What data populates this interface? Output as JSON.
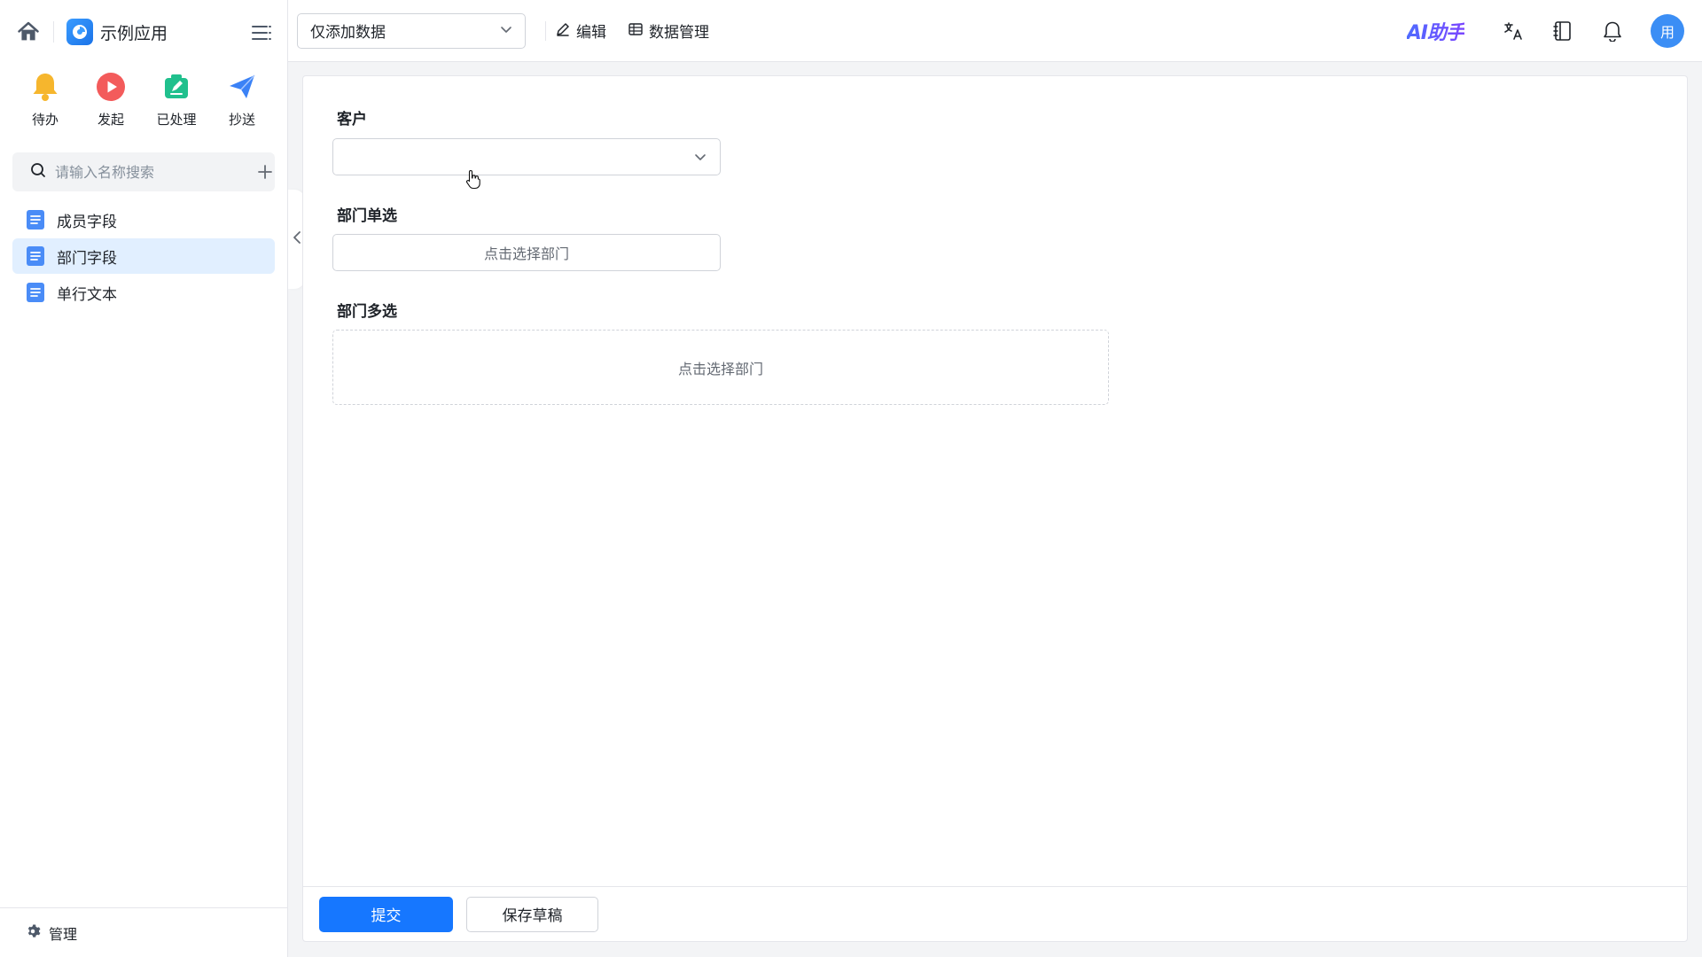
{
  "app": {
    "name": "示例应用"
  },
  "quick_actions": [
    {
      "label": "待办",
      "icon": "bell-icon",
      "color": "#f6b62d"
    },
    {
      "label": "发起",
      "icon": "play-icon",
      "color": "#f35b5b"
    },
    {
      "label": "已处理",
      "icon": "edit-square-icon",
      "color": "#20c08d"
    },
    {
      "label": "抄送",
      "icon": "paper-plane-icon",
      "color": "#3b82f6"
    }
  ],
  "search": {
    "placeholder": "请输入名称搜索"
  },
  "nav": {
    "items": [
      {
        "label": "成员字段",
        "active": false
      },
      {
        "label": "部门字段",
        "active": true
      },
      {
        "label": "单行文本",
        "active": false
      }
    ]
  },
  "footer": {
    "manage_label": "管理"
  },
  "topbar": {
    "view_select": "仅添加数据",
    "edit_label": "编辑",
    "data_manage_label": "数据管理",
    "ai_helper": "AI助手",
    "avatar_text": "用"
  },
  "form": {
    "customer_label": "客户",
    "customer_value": "",
    "dept_single_label": "部门单选",
    "dept_single_placeholder": "点击选择部门",
    "dept_multi_label": "部门多选",
    "dept_multi_placeholder": "点击选择部门"
  },
  "buttons": {
    "submit": "提交",
    "save_draft": "保存草稿"
  },
  "colors": {
    "primary": "#1677ff",
    "active_nav_bg": "#e1efff",
    "doc_icon": "#4a8cf7"
  }
}
